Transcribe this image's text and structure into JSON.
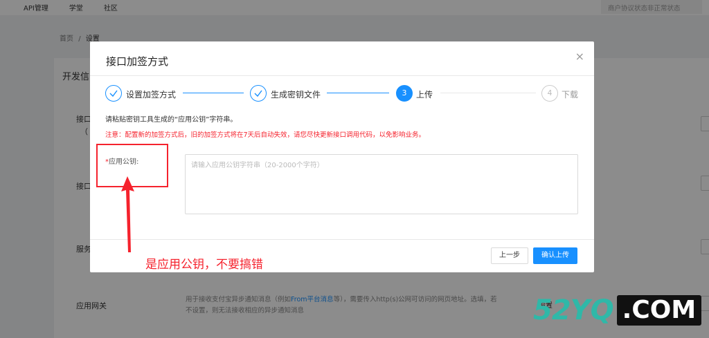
{
  "topnav": {
    "items": [
      "API管理",
      "学堂",
      "社区"
    ],
    "status": "商户协议状态非正常状态"
  },
  "breadcrumb": {
    "home": "首页",
    "sep": "/",
    "current": "设置"
  },
  "panel": {
    "title": "开发信",
    "rows": [
      "接口",
      "（",
      "接口",
      "服务",
      "应用网关"
    ],
    "gateway_desc_1": "用于接收支付宝异步通知消息（例如",
    "gateway_desc_link": "From平台消息",
    "gateway_desc_2": "等），需要传入http(s)公网可访问的网页地址。选填，若不设置，则无法接收相应的异步通知消息",
    "setting": "设置"
  },
  "modal": {
    "title": "接口加签方式",
    "close": "×",
    "steps": [
      {
        "label": "设置加签方式",
        "status": "done",
        "icon": "check-icon"
      },
      {
        "label": "生成密钥文件",
        "status": "done",
        "icon": "check-icon"
      },
      {
        "label": "上传",
        "status": "active",
        "num": "3"
      },
      {
        "label": "下载",
        "status": "wait",
        "num": "4"
      }
    ],
    "hint": "请粘贴密钥工具生成的“应用公钥”字符串。",
    "warning": "注意：配置新的加签方式后，旧的加签方式将在7天后自动失效，请您尽快更新接口调用代码，以免影响业务。",
    "field": {
      "required": "*",
      "label": "应用公钥:",
      "placeholder": "请输入应用公钥字符串（20-2000个字符）"
    },
    "buttons": {
      "prev": "上一步",
      "confirm": "确认上传"
    }
  },
  "annotation": {
    "text": "是应用公钥，不要搞错",
    "color": "#f5222d"
  },
  "watermark": {
    "num": "52",
    "yq": "YQ",
    "com": ".COM"
  },
  "colors": {
    "accent": "#1890ff",
    "warn": "#f5222d",
    "watermark": "#2fb8a8"
  }
}
